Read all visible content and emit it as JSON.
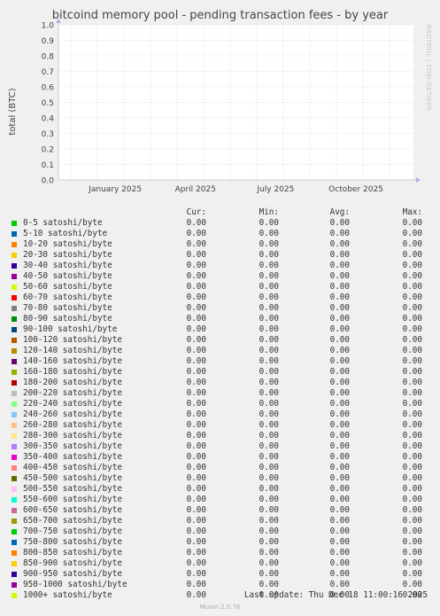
{
  "chart_data": {
    "type": "area",
    "title": "bitcoind memory pool - pending transaction fees - by year",
    "ylabel": "total (BTC)",
    "xlabel": "",
    "ylim": [
      0,
      1
    ],
    "yticks": [
      "0.0",
      "0.1",
      "0.2",
      "0.3",
      "0.4",
      "0.5",
      "0.6",
      "0.7",
      "0.8",
      "0.9",
      "1.0"
    ],
    "xticks": [
      "January 2025",
      "April 2025",
      "July 2025",
      "October 2025"
    ],
    "grid": true,
    "colors": {
      "plot_background": "#ffffff",
      "grid": "#e8b0b0",
      "axis": "#cccccc",
      "arrow": "#aab0e8"
    },
    "series": [
      {
        "name": "0-5 satoshi/byte",
        "color": "#00cc00",
        "cur": "0.00",
        "min": "0.00",
        "avg": "0.00",
        "max": "0.00"
      },
      {
        "name": "5-10 satoshi/byte",
        "color": "#0066b3",
        "cur": "0.00",
        "min": "0.00",
        "avg": "0.00",
        "max": "0.00"
      },
      {
        "name": "10-20 satoshi/byte",
        "color": "#ff8000",
        "cur": "0.00",
        "min": "0.00",
        "avg": "0.00",
        "max": "0.00"
      },
      {
        "name": "20-30 satoshi/byte",
        "color": "#ffcc00",
        "cur": "0.00",
        "min": "0.00",
        "avg": "0.00",
        "max": "0.00"
      },
      {
        "name": "30-40 satoshi/byte",
        "color": "#330099",
        "cur": "0.00",
        "min": "0.00",
        "avg": "0.00",
        "max": "0.00"
      },
      {
        "name": "40-50 satoshi/byte",
        "color": "#990099",
        "cur": "0.00",
        "min": "0.00",
        "avg": "0.00",
        "max": "0.00"
      },
      {
        "name": "50-60 satoshi/byte",
        "color": "#ccff00",
        "cur": "0.00",
        "min": "0.00",
        "avg": "0.00",
        "max": "0.00"
      },
      {
        "name": "60-70 satoshi/byte",
        "color": "#ff0000",
        "cur": "0.00",
        "min": "0.00",
        "avg": "0.00",
        "max": "0.00"
      },
      {
        "name": "70-80 satoshi/byte",
        "color": "#808080",
        "cur": "0.00",
        "min": "0.00",
        "avg": "0.00",
        "max": "0.00"
      },
      {
        "name": "80-90 satoshi/byte",
        "color": "#008f00",
        "cur": "0.00",
        "min": "0.00",
        "avg": "0.00",
        "max": "0.00"
      },
      {
        "name": "90-100 satoshi/byte",
        "color": "#00487d",
        "cur": "0.00",
        "min": "0.00",
        "avg": "0.00",
        "max": "0.00"
      },
      {
        "name": "100-120 satoshi/byte",
        "color": "#b35a00",
        "cur": "0.00",
        "min": "0.00",
        "avg": "0.00",
        "max": "0.00"
      },
      {
        "name": "120-140 satoshi/byte",
        "color": "#b38f00",
        "cur": "0.00",
        "min": "0.00",
        "avg": "0.00",
        "max": "0.00"
      },
      {
        "name": "140-160 satoshi/byte",
        "color": "#6b006b",
        "cur": "0.00",
        "min": "0.00",
        "avg": "0.00",
        "max": "0.00"
      },
      {
        "name": "160-180 satoshi/byte",
        "color": "#8fb300",
        "cur": "0.00",
        "min": "0.00",
        "avg": "0.00",
        "max": "0.00"
      },
      {
        "name": "180-200 satoshi/byte",
        "color": "#b30000",
        "cur": "0.00",
        "min": "0.00",
        "avg": "0.00",
        "max": "0.00"
      },
      {
        "name": "200-220 satoshi/byte",
        "color": "#bebebe",
        "cur": "0.00",
        "min": "0.00",
        "avg": "0.00",
        "max": "0.00"
      },
      {
        "name": "220-240 satoshi/byte",
        "color": "#80ff80",
        "cur": "0.00",
        "min": "0.00",
        "avg": "0.00",
        "max": "0.00"
      },
      {
        "name": "240-260 satoshi/byte",
        "color": "#80c9ff",
        "cur": "0.00",
        "min": "0.00",
        "avg": "0.00",
        "max": "0.00"
      },
      {
        "name": "260-280 satoshi/byte",
        "color": "#ffc080",
        "cur": "0.00",
        "min": "0.00",
        "avg": "0.00",
        "max": "0.00"
      },
      {
        "name": "280-300 satoshi/byte",
        "color": "#ffe680",
        "cur": "0.00",
        "min": "0.00",
        "avg": "0.00",
        "max": "0.00"
      },
      {
        "name": "300-350 satoshi/byte",
        "color": "#aa80ff",
        "cur": "0.00",
        "min": "0.00",
        "avg": "0.00",
        "max": "0.00"
      },
      {
        "name": "350-400 satoshi/byte",
        "color": "#ee00cc",
        "cur": "0.00",
        "min": "0.00",
        "avg": "0.00",
        "max": "0.00"
      },
      {
        "name": "400-450 satoshi/byte",
        "color": "#ff8080",
        "cur": "0.00",
        "min": "0.00",
        "avg": "0.00",
        "max": "0.00"
      },
      {
        "name": "450-500 satoshi/byte",
        "color": "#666600",
        "cur": "0.00",
        "min": "0.00",
        "avg": "0.00",
        "max": "0.00"
      },
      {
        "name": "500-550 satoshi/byte",
        "color": "#ffbfff",
        "cur": "0.00",
        "min": "0.00",
        "avg": "0.00",
        "max": "0.00"
      },
      {
        "name": "550-600 satoshi/byte",
        "color": "#00ffcc",
        "cur": "0.00",
        "min": "0.00",
        "avg": "0.00",
        "max": "0.00"
      },
      {
        "name": "600-650 satoshi/byte",
        "color": "#cc6699",
        "cur": "0.00",
        "min": "0.00",
        "avg": "0.00",
        "max": "0.00"
      },
      {
        "name": "650-700 satoshi/byte",
        "color": "#999900",
        "cur": "0.00",
        "min": "0.00",
        "avg": "0.00",
        "max": "0.00"
      },
      {
        "name": "700-750 satoshi/byte",
        "color": "#00cc00",
        "cur": "0.00",
        "min": "0.00",
        "avg": "0.00",
        "max": "0.00"
      },
      {
        "name": "750-800 satoshi/byte",
        "color": "#0066b3",
        "cur": "0.00",
        "min": "0.00",
        "avg": "0.00",
        "max": "0.00"
      },
      {
        "name": "800-850 satoshi/byte",
        "color": "#ff8000",
        "cur": "0.00",
        "min": "0.00",
        "avg": "0.00",
        "max": "0.00"
      },
      {
        "name": "850-900 satoshi/byte",
        "color": "#ffcc00",
        "cur": "0.00",
        "min": "0.00",
        "avg": "0.00",
        "max": "0.00"
      },
      {
        "name": "900-950 satoshi/byte",
        "color": "#330099",
        "cur": "0.00",
        "min": "0.00",
        "avg": "0.00",
        "max": "0.00"
      },
      {
        "name": "950-1000 satoshi/byte",
        "color": "#990099",
        "cur": "0.00",
        "min": "0.00",
        "avg": "0.00",
        "max": "0.00"
      },
      {
        "name": "1000+ satoshi/byte",
        "color": "#ccff00",
        "cur": "0.00",
        "min": "0.00",
        "avg": "0.00",
        "max": "0.00"
      }
    ]
  },
  "legend_headers": {
    "cur": "Cur:",
    "min": "Min:",
    "avg": "Avg:",
    "max": "Max:"
  },
  "last_update": "Last update: Thu Dec 18 11:00:16 2025",
  "watermark": "RRDTOOL / TOBI OETIKER",
  "footer": "Munin 2.0.76"
}
